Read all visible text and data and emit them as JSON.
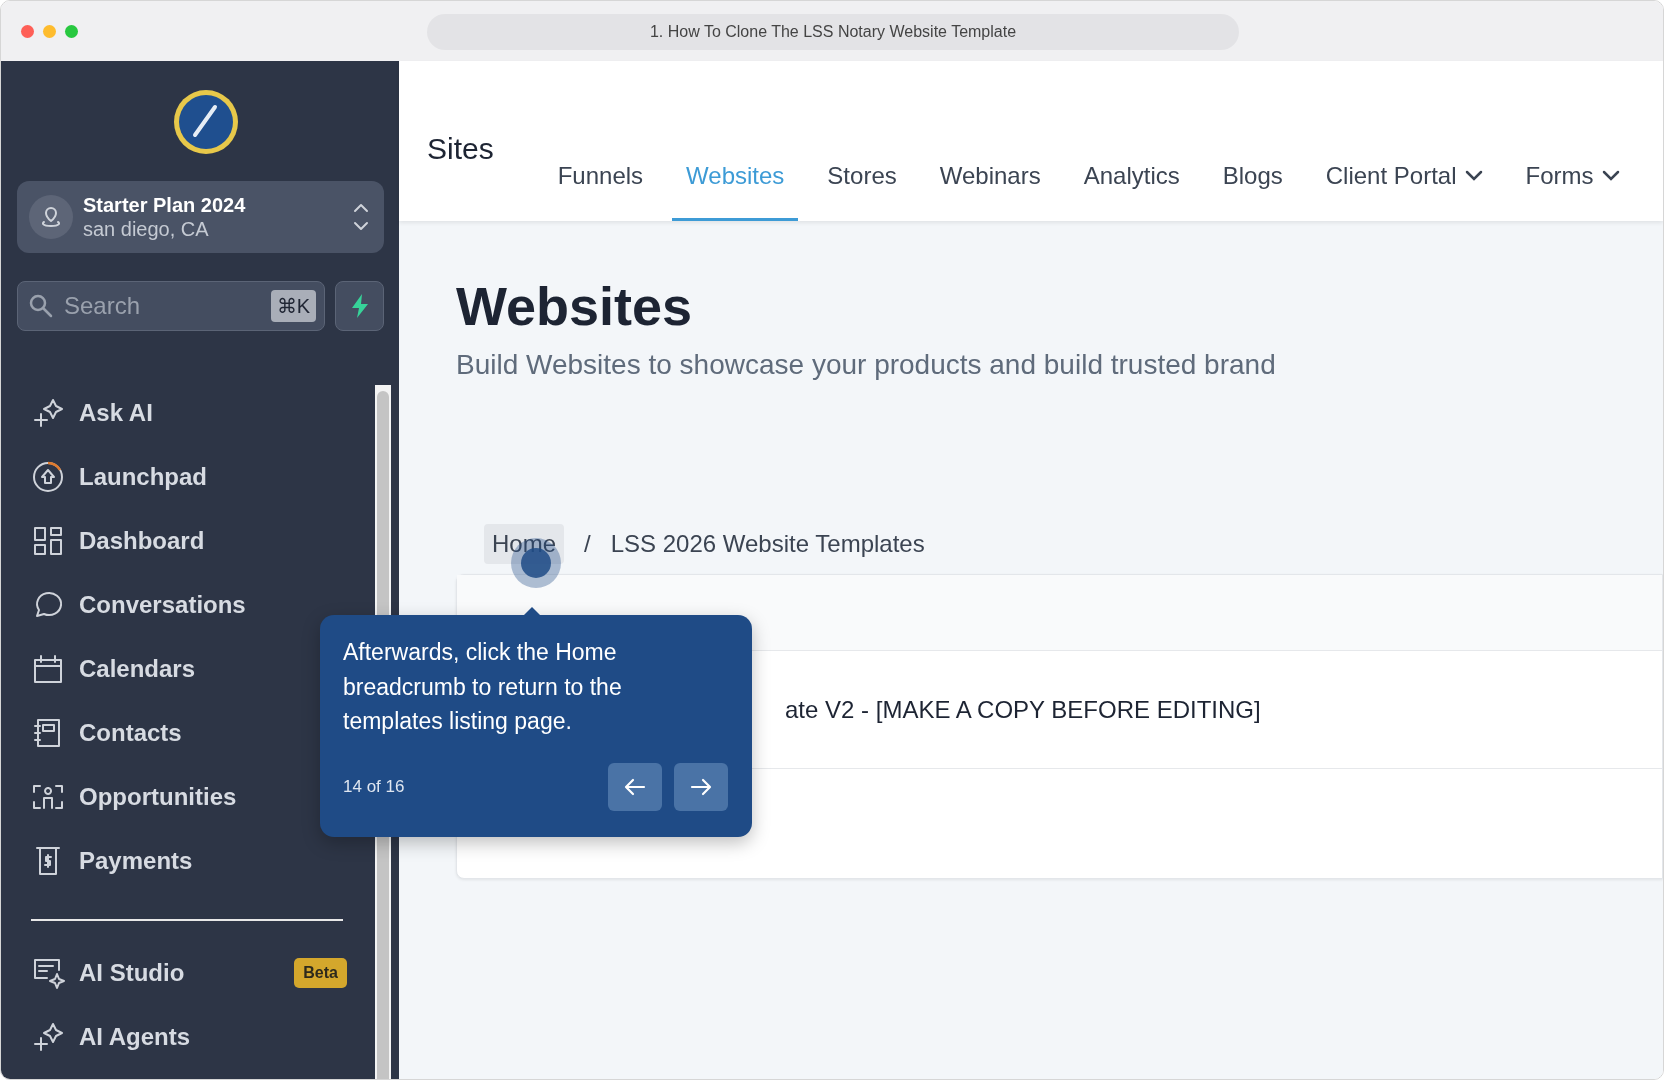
{
  "window": {
    "title": "1. How To Clone The LSS Notary Website Template"
  },
  "sidebar": {
    "account": {
      "name": "Starter Plan 2024",
      "location": "san diego, CA"
    },
    "search": {
      "placeholder": "Search",
      "shortcut": "⌘K"
    },
    "items": [
      {
        "label": "Ask AI"
      },
      {
        "label": "Launchpad"
      },
      {
        "label": "Dashboard"
      },
      {
        "label": "Conversations"
      },
      {
        "label": "Calendars"
      },
      {
        "label": "Contacts"
      },
      {
        "label": "Opportunities"
      },
      {
        "label": "Payments"
      }
    ],
    "items_bottom": [
      {
        "label": "AI Studio",
        "badge": "Beta"
      },
      {
        "label": "AI Agents"
      }
    ]
  },
  "top_nav": {
    "title": "Sites",
    "tabs": [
      {
        "label": "Funnels",
        "selected": false,
        "dropdown": false
      },
      {
        "label": "Websites",
        "selected": true,
        "dropdown": false
      },
      {
        "label": "Stores",
        "selected": false,
        "dropdown": false
      },
      {
        "label": "Webinars",
        "selected": false,
        "dropdown": false
      },
      {
        "label": "Analytics",
        "selected": false,
        "dropdown": false
      },
      {
        "label": "Blogs",
        "selected": false,
        "dropdown": false
      },
      {
        "label": "Client Portal",
        "selected": false,
        "dropdown": true
      },
      {
        "label": "Forms",
        "selected": false,
        "dropdown": true
      }
    ]
  },
  "page": {
    "title": "Websites",
    "subtitle": "Build Websites to showcase your products and build trusted brand",
    "breadcrumb": [
      {
        "label": "Home"
      },
      {
        "label": "LSS 2026 Website Templates"
      }
    ],
    "breadcrumb_separator": "/",
    "table": {
      "rows": [
        {
          "name": "ate V2 - [MAKE A COPY BEFORE EDITING]"
        }
      ]
    }
  },
  "tour": {
    "text": "Afterwards, click the Home breadcrumb to return to the templates listing page.",
    "step": "14 of 16",
    "buttons": [
      {
        "kind": "back"
      },
      {
        "kind": "next"
      }
    ]
  }
}
